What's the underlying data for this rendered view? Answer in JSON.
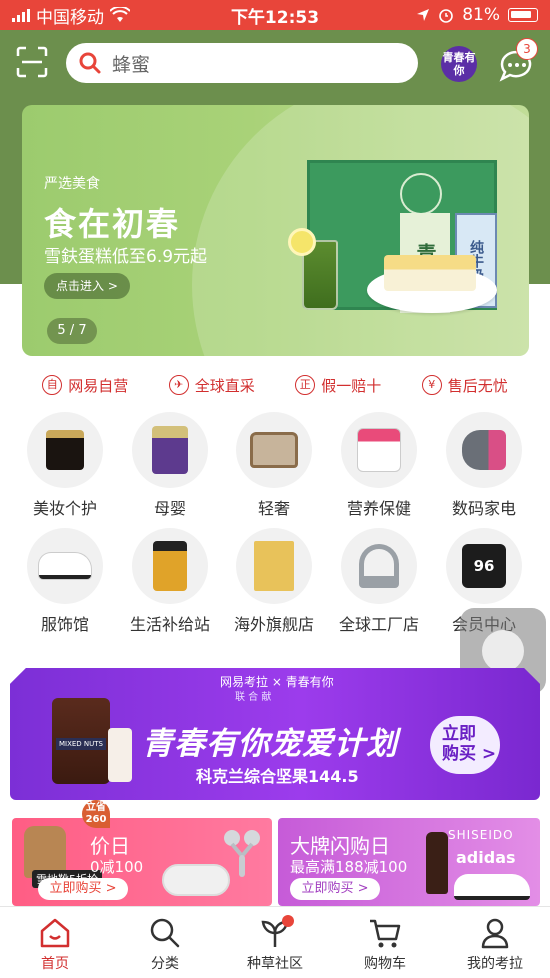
{
  "status_bar": {
    "carrier": "中国移动",
    "time": "下午12:53",
    "battery": "81%"
  },
  "header": {
    "search_placeholder": "蜂蜜",
    "youth_badge": "青春有你",
    "message_count": "3",
    "bg_color": "#6c8f4d"
  },
  "banner": {
    "kicker": "严选美食",
    "title": "食在初春",
    "subtitle": "雪鈇蛋糕低至6.9元起",
    "cta": "点击进入 >",
    "pager": "5 / 7",
    "product_label": "青汁",
    "milk_label": "纯牛奶"
  },
  "features": [
    {
      "icon": "自",
      "label": "网易自营"
    },
    {
      "icon": "✈",
      "label": "全球直采"
    },
    {
      "icon": "正",
      "label": "假一赔十"
    },
    {
      "icon": "¥",
      "label": "售后无忧"
    }
  ],
  "categories": [
    {
      "label": "美妆个护"
    },
    {
      "label": "母婴"
    },
    {
      "label": "轻奢"
    },
    {
      "label": "营养保健"
    },
    {
      "label": "数码家电"
    },
    {
      "label": "服饰馆"
    },
    {
      "label": "生活补给站"
    },
    {
      "label": "海外旗舰店"
    },
    {
      "label": "全球工厂店"
    },
    {
      "label": "会员中心"
    }
  ],
  "promo": {
    "brand": "网易考拉 × 青春有你",
    "brand_sub": "联 合 献",
    "title": "青春有你宠爱计划",
    "subtitle": "科克兰综合坚果144.5",
    "cta_line1": "立即",
    "cta_line2": "购买 >",
    "jar_label": "MIXED NUTS"
  },
  "sales": {
    "left": {
      "title": "价日",
      "subtitle": "0减100",
      "button": "立即购买 >",
      "badge": "雪地靴5折抢",
      "tag": "立省260"
    },
    "right": {
      "title": "大牌闪购日",
      "subtitle": "最高满188减100",
      "button": "立即购买 >",
      "brand1": "SHISEIDO",
      "brand2": "adidas"
    }
  },
  "tabbar": [
    {
      "label": "首页"
    },
    {
      "label": "分类"
    },
    {
      "label": "种草社区"
    },
    {
      "label": "购物车"
    },
    {
      "label": "我的考拉"
    }
  ]
}
